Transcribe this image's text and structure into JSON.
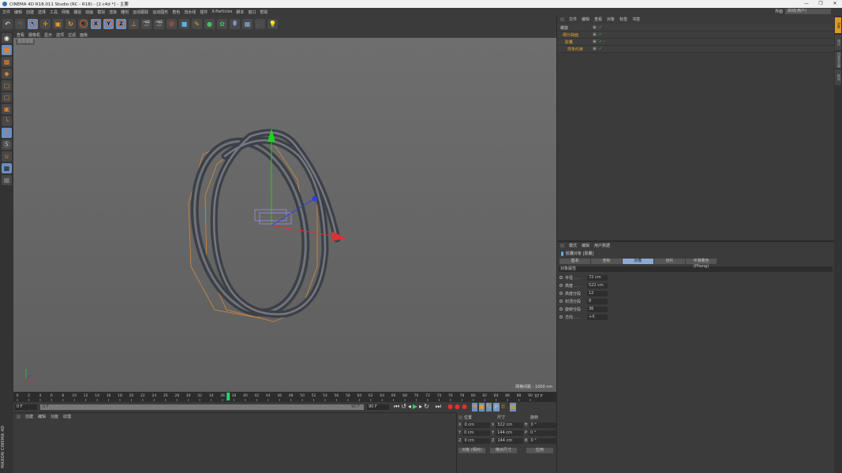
{
  "title": "CINEMA 4D R18.011 Studio (RC - R18) - [2.c4d *] - 主要",
  "window_controls": [
    "—",
    "❐",
    "✕"
  ],
  "menu": [
    "文件",
    "编辑",
    "创建",
    "选择",
    "工具",
    "网格",
    "捕捉",
    "动画",
    "模拟",
    "渲染",
    "雕刻",
    "运动跟踪",
    "运动图形",
    "角色",
    "流水线",
    "插件",
    "X-Particles",
    "脚本",
    "窗口",
    "帮助"
  ],
  "layout": {
    "label": "界面",
    "value": "启动(用户)"
  },
  "toolbar": {
    "axis_x": "X",
    "axis_y": "Y",
    "axis_z": "Z"
  },
  "viewport": {
    "menu": [
      "查看",
      "摄像机",
      "显示",
      "选项",
      "过滤",
      "面板"
    ],
    "label": "透视视图",
    "grid_info": "网格间距 : 1000 cm"
  },
  "timeline": {
    "start": 0,
    "end": 90,
    "step": 2,
    "current": 37,
    "current_label": "37 F",
    "start_field": "0 F",
    "range_start": "0 F",
    "range_end": "90 F",
    "end_field": "90 F"
  },
  "material_manager": {
    "menu": [
      "创建",
      "编辑",
      "功能",
      "纹理"
    ]
  },
  "coordinates": {
    "headers": [
      "位置",
      "尺寸",
      "旋转"
    ],
    "rows": [
      {
        "axis": "X",
        "pos": "0 cm",
        "size_axis": "X",
        "size": "522 cm",
        "rot_axis": "H",
        "rot": "0 °"
      },
      {
        "axis": "Y",
        "pos": "0 cm",
        "size_axis": "Y",
        "size": "144 cm",
        "rot_axis": "P",
        "rot": "0 °"
      },
      {
        "axis": "Z",
        "pos": "0 cm",
        "size_axis": "Z",
        "size": "144 cm",
        "rot_axis": "B",
        "rot": "0 °"
      }
    ],
    "mode": "对象 (相对)",
    "size_mode": "绝对尺寸",
    "apply": "应用"
  },
  "object_manager": {
    "menu": [
      "文件",
      "编辑",
      "查看",
      "对象",
      "标签",
      "书签"
    ],
    "objects": [
      {
        "name": "螺旋",
        "color": "#c8c8c8"
      },
      {
        "name": "细分曲面",
        "color": "#e0a030"
      },
      {
        "name": "胶囊",
        "color": "#e0a030"
      },
      {
        "name": "样条约束",
        "color": "#e0a030"
      }
    ]
  },
  "attribute_manager": {
    "menu": [
      "模式",
      "编辑",
      "用户数据"
    ],
    "object_title": "胶囊对象 [胶囊]",
    "tabs": [
      "基本",
      "坐标",
      "对象",
      "切片",
      "平滑着色(Phong)"
    ],
    "active_tab": 2,
    "section": "对象属性",
    "props": [
      {
        "label": "半径 . . .",
        "value": "72 cm"
      },
      {
        "label": "高度 . . .",
        "value": "522 cm"
      },
      {
        "label": "高度分段",
        "value": "12"
      },
      {
        "label": "封顶分段",
        "value": "8"
      },
      {
        "label": "旋转分段",
        "value": "36"
      },
      {
        "label": "方向 . . .",
        "value": "+X"
      }
    ]
  },
  "right_tabs": [
    "对象",
    "场次",
    "内容浏览器",
    "构造"
  ],
  "brand": "MAXON CINEMA 4D",
  "colors": {
    "accent": "#6d8fbf",
    "selected_tab": "#8aa9d6",
    "highlight_object": "#e0a030",
    "playhead": "#2fd070"
  }
}
